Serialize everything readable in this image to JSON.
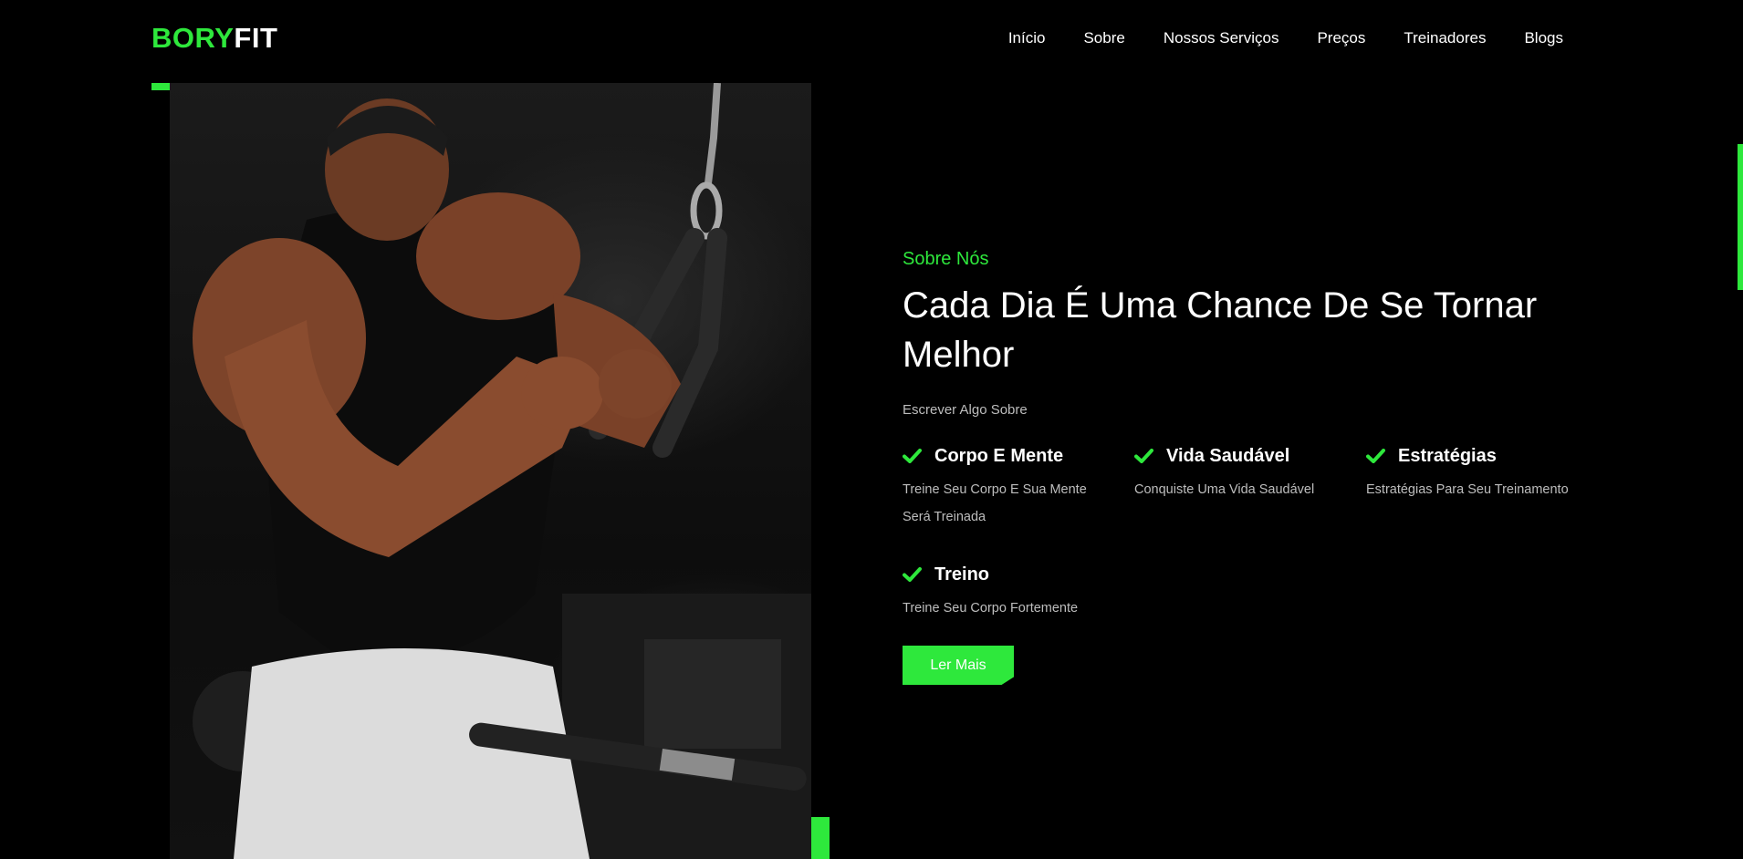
{
  "brand": {
    "logo_accent": "BORY",
    "logo_rest": "FIT",
    "accent_color": "#2ee83c"
  },
  "nav": {
    "items": [
      "Início",
      "Sobre",
      "Nossos Serviços",
      "Preços",
      "Treinadores",
      "Blogs"
    ]
  },
  "hero_image": {
    "alt": "bodybuilder"
  },
  "about": {
    "eyebrow": "Sobre Nós",
    "title": "Cada Dia É Uma Chance De Se Tornar Melhor",
    "subtitle": "Escrever Algo Sobre",
    "features": [
      {
        "icon": "check-icon",
        "title": "Corpo E Mente",
        "description": "Treine Seu Corpo E Sua Mente Será Treinada"
      },
      {
        "icon": "check-icon",
        "title": "Vida Saudável",
        "description": "Conquiste Uma Vida Saudável"
      },
      {
        "icon": "check-icon",
        "title": "Estratégias",
        "description": "Estratégias Para Seu Treinamento"
      },
      {
        "icon": "check-icon",
        "title": "Treino",
        "description": "Treine Seu Corpo Fortemente"
      }
    ],
    "cta_label": "Ler Mais"
  }
}
